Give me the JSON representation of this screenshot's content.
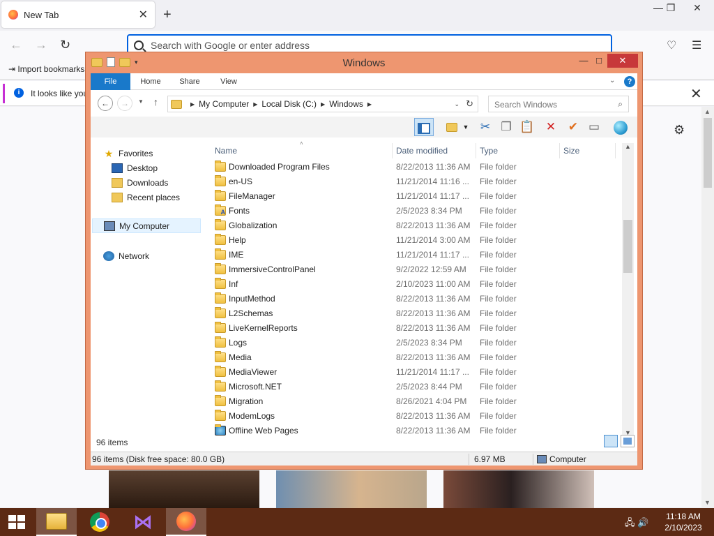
{
  "firefox": {
    "tab_title": "New Tab",
    "tab_close": "✕",
    "new_tab": "+",
    "win_min": "—",
    "win_max": "❐",
    "win_close": "✕",
    "back": "←",
    "forward": "→",
    "reload": "↻",
    "url_placeholder": "Search with Google or enter address",
    "pocket": "♡",
    "menu": "☰",
    "import_bookmarks": "Import bookmarks",
    "import_icon": "⇥",
    "notice_text": "It looks like you",
    "notice_info": "i",
    "notice_close": "✕",
    "gear": "⚙"
  },
  "explorer": {
    "title": "Windows",
    "qat_dropdown": "▾",
    "minimize": "—",
    "maximize": "□",
    "close": "✕",
    "ribbon_tabs": [
      "File",
      "Home",
      "Share",
      "View"
    ],
    "ribbon_expand": "⌄",
    "help": "?",
    "nav_back": "←",
    "nav_forward": "→",
    "recent_dropdown": "▼",
    "nav_up": "↑",
    "breadcrumb": [
      "My Computer",
      "Local Disk (C:)",
      "Windows"
    ],
    "address_dropdown": "⌄",
    "refresh": "↻",
    "search_placeholder": "Search Windows",
    "search_icon": "⌕",
    "toolbar_icons": {
      "cut": "✂",
      "copy": "❐",
      "paste": "📋",
      "delete": "✕",
      "check": "✔",
      "rename": "▭",
      "dropdown": "▼"
    },
    "nav_pane": [
      {
        "label": "Favorites",
        "icon": "star-icon"
      },
      {
        "label": "Desktop",
        "icon": "desktop-icon"
      },
      {
        "label": "Downloads",
        "icon": "downloads-icon"
      },
      {
        "label": "Recent places",
        "icon": "recent-places-icon"
      },
      {
        "label": "My Computer",
        "icon": "computer-icon"
      },
      {
        "label": "Network",
        "icon": "network-icon"
      }
    ],
    "columns": [
      "Name",
      "Date modified",
      "Type",
      "Size"
    ],
    "sort_arrow": "˄",
    "files": [
      {
        "name": "Downloaded Program Files",
        "date": "8/22/2013 11:36 AM",
        "type": "File folder"
      },
      {
        "name": "en-US",
        "date": "11/21/2014 11:16 ...",
        "type": "File folder"
      },
      {
        "name": "FileManager",
        "date": "11/21/2014 11:17 ...",
        "type": "File folder"
      },
      {
        "name": "Fonts",
        "date": "2/5/2023 8:34 PM",
        "type": "File folder"
      },
      {
        "name": "Globalization",
        "date": "8/22/2013 11:36 AM",
        "type": "File folder"
      },
      {
        "name": "Help",
        "date": "11/21/2014 3:00 AM",
        "type": "File folder"
      },
      {
        "name": "IME",
        "date": "11/21/2014 11:17 ...",
        "type": "File folder"
      },
      {
        "name": "ImmersiveControlPanel",
        "date": "9/2/2022 12:59 AM",
        "type": "File folder"
      },
      {
        "name": "Inf",
        "date": "2/10/2023 11:00 AM",
        "type": "File folder"
      },
      {
        "name": "InputMethod",
        "date": "8/22/2013 11:36 AM",
        "type": "File folder"
      },
      {
        "name": "L2Schemas",
        "date": "8/22/2013 11:36 AM",
        "type": "File folder"
      },
      {
        "name": "LiveKernelReports",
        "date": "8/22/2013 11:36 AM",
        "type": "File folder"
      },
      {
        "name": "Logs",
        "date": "2/5/2023 8:34 PM",
        "type": "File folder"
      },
      {
        "name": "Media",
        "date": "8/22/2013 11:36 AM",
        "type": "File folder"
      },
      {
        "name": "MediaViewer",
        "date": "11/21/2014 11:17 ...",
        "type": "File folder"
      },
      {
        "name": "Microsoft.NET",
        "date": "2/5/2023 8:44 PM",
        "type": "File folder"
      },
      {
        "name": "Migration",
        "date": "8/26/2021 4:04 PM",
        "type": "File folder"
      },
      {
        "name": "ModemLogs",
        "date": "8/22/2013 11:36 AM",
        "type": "File folder"
      },
      {
        "name": "Offline Web Pages",
        "date": "8/22/2013 11:36 AM",
        "type": "File folder"
      }
    ],
    "scroll_up": "▲",
    "scroll_down": "▼",
    "item_count": "96 items",
    "status_left": "96 items (Disk free space: 80.0 GB)",
    "status_size": "6.97 MB",
    "status_location": "Computer"
  },
  "taskbar": {
    "tray_icons": "🖧 🔊",
    "time": "11:18 AM",
    "date": "2/10/2023",
    "vs_glyph": "⋈"
  }
}
